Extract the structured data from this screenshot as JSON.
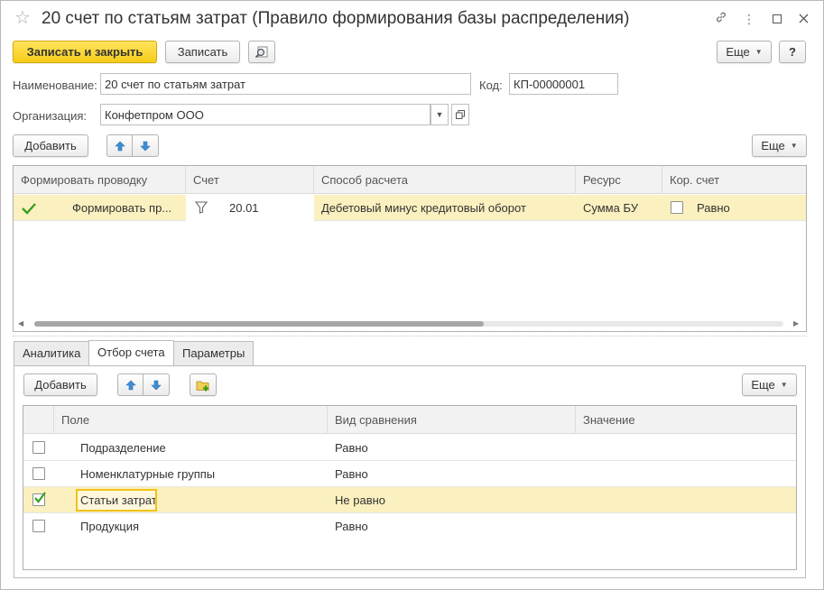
{
  "window": {
    "title": "20 счет по статьям затрат (Правило формирования базы распределения)"
  },
  "toolbar": {
    "save_close_label": "Записать и закрыть",
    "save_label": "Записать",
    "more_label": "Еще",
    "help_label": "?"
  },
  "form": {
    "name_label": "Наименование:",
    "name_value": "20 счет по статьям затрат",
    "code_label": "Код:",
    "code_value": "КП-00000001",
    "org_label": "Организация:",
    "org_value": "Конфетпром ООО"
  },
  "rules_toolbar": {
    "add_label": "Добавить",
    "more_label": "Еще"
  },
  "rules_table": {
    "columns": [
      "Формировать проводку",
      "Счет",
      "Способ расчета",
      "Ресурс",
      "Кор. счет"
    ],
    "rows": [
      {
        "form_posting": "Формировать пр...",
        "account": "20.01",
        "method": "Дебетовый минус кредитовый оборот",
        "resource": "Сумма БУ",
        "corr_account": "Равно"
      }
    ],
    "scroll_fraction": 0.6
  },
  "tabs": [
    "Аналитика",
    "Отбор счета",
    "Параметры"
  ],
  "filter_toolbar": {
    "add_label": "Добавить",
    "more_label": "Еще"
  },
  "filter_table": {
    "columns": [
      "Поле",
      "Вид сравнения",
      "Значение"
    ],
    "rows": [
      {
        "field": "Подразделение",
        "comparison": "Равно",
        "value": "",
        "checked": false
      },
      {
        "field": "Номенклатурные группы",
        "comparison": "Равно",
        "value": "",
        "checked": false
      },
      {
        "field": "Статьи затрат",
        "comparison": "Не равно",
        "value": "",
        "checked": true
      },
      {
        "field": "Продукция",
        "comparison": "Равно",
        "value": "",
        "checked": false
      }
    ]
  },
  "colors": {
    "primary_button": "#f5cc17",
    "selected_row": "#fbf0bf",
    "check_green": "#3a9d23",
    "arrow_blue": "#3d8fd1"
  }
}
